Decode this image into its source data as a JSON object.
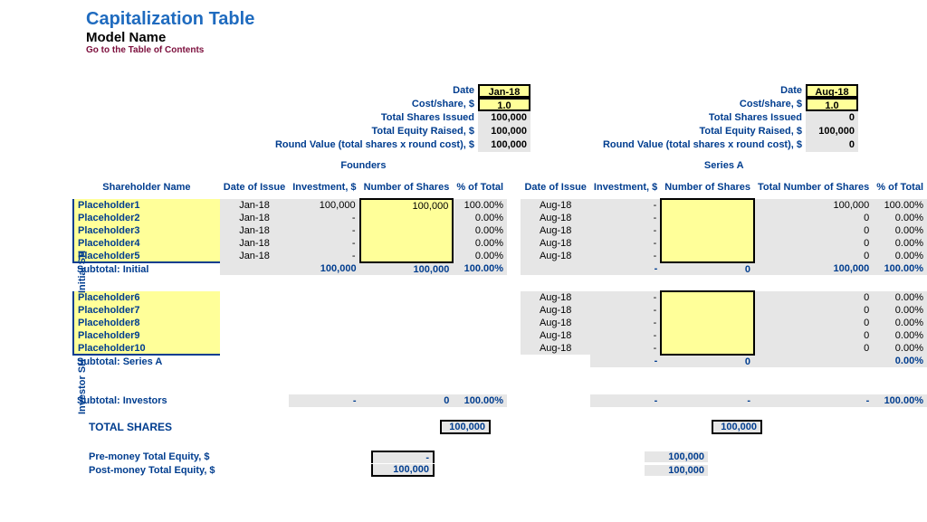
{
  "header": {
    "title": "Capitalization Table",
    "subtitle": "Model Name",
    "link": "Go to the Table of Contents"
  },
  "metrics": {
    "labels": {
      "date": "Date",
      "cost": "Cost/share, $",
      "shares": "Total Shares Issued",
      "equity": "Total Equity Raised, $",
      "roundval": "Round Value (total shares x round cost), $"
    },
    "founders": {
      "date": "Jan-18",
      "cost": "1.0",
      "shares": "100,000",
      "equity": "100,000",
      "roundval": "100,000"
    },
    "seriesA": {
      "date": "Aug-18",
      "cost": "1.0",
      "shares": "0",
      "equity": "100,000",
      "roundval": "0"
    }
  },
  "table": {
    "groups": {
      "founders": "Founders",
      "seriesA": "Series A"
    },
    "headers": {
      "shareholder": "Shareholder Name",
      "date": "Date of Issue",
      "investment": "Investment, $",
      "shares": "Number of Shares",
      "totalShares": "Total Number of Shares",
      "pct": "% of Total"
    },
    "vert": {
      "initial": "Initial SH",
      "investor": "Investor SH"
    },
    "rows_initial": [
      {
        "name": "Placeholder1",
        "f_date": "Jan-18",
        "f_inv": "100,000",
        "f_sh": "100,000",
        "f_pct": "100.00%",
        "a_date": "Aug-18",
        "a_inv": "-",
        "a_sh": "",
        "a_tsh": "100,000",
        "a_pct": "100.00%"
      },
      {
        "name": "Placeholder2",
        "f_date": "Jan-18",
        "f_inv": "-",
        "f_sh": "",
        "f_pct": "0.00%",
        "a_date": "Aug-18",
        "a_inv": "-",
        "a_sh": "",
        "a_tsh": "0",
        "a_pct": "0.00%"
      },
      {
        "name": "Placeholder3",
        "f_date": "Jan-18",
        "f_inv": "-",
        "f_sh": "",
        "f_pct": "0.00%",
        "a_date": "Aug-18",
        "a_inv": "-",
        "a_sh": "",
        "a_tsh": "0",
        "a_pct": "0.00%"
      },
      {
        "name": "Placeholder4",
        "f_date": "Jan-18",
        "f_inv": "-",
        "f_sh": "",
        "f_pct": "0.00%",
        "a_date": "Aug-18",
        "a_inv": "-",
        "a_sh": "",
        "a_tsh": "0",
        "a_pct": "0.00%"
      },
      {
        "name": "Placeholder5",
        "f_date": "Jan-18",
        "f_inv": "-",
        "f_sh": "",
        "f_pct": "0.00%",
        "a_date": "Aug-18",
        "a_inv": "-",
        "a_sh": "",
        "a_tsh": "0",
        "a_pct": "0.00%"
      }
    ],
    "subtotal_initial": {
      "label": "Subtotal: Initial",
      "f_inv": "100,000",
      "f_sh": "100,000",
      "f_pct": "100.00%",
      "a_inv": "-",
      "a_sh": "0",
      "a_tsh": "100,000",
      "a_pct": "100.00%"
    },
    "rows_investor": [
      {
        "name": "Placeholder6",
        "a_date": "Aug-18",
        "a_inv": "-",
        "a_sh": "",
        "a_tsh": "0",
        "a_pct": "0.00%"
      },
      {
        "name": "Placeholder7",
        "a_date": "Aug-18",
        "a_inv": "-",
        "a_sh": "",
        "a_tsh": "0",
        "a_pct": "0.00%"
      },
      {
        "name": "Placeholder8",
        "a_date": "Aug-18",
        "a_inv": "-",
        "a_sh": "",
        "a_tsh": "0",
        "a_pct": "0.00%"
      },
      {
        "name": "Placeholder9",
        "a_date": "Aug-18",
        "a_inv": "-",
        "a_sh": "",
        "a_tsh": "0",
        "a_pct": "0.00%"
      },
      {
        "name": "Placeholder10",
        "a_date": "Aug-18",
        "a_inv": "-",
        "a_sh": "",
        "a_tsh": "0",
        "a_pct": "0.00%"
      }
    ],
    "subtotal_seriesA": {
      "label": "Subtotal: Series A",
      "a_inv": "-",
      "a_sh": "0",
      "a_tsh": "",
      "a_pct": "0.00%"
    },
    "subtotal_investors": {
      "label": "Subtotal: Investors",
      "f_inv": "-",
      "f_sh": "0",
      "f_pct": "100.00%",
      "a_inv": "-",
      "a_sh": "-",
      "a_tsh": "-",
      "a_pct": "100.00%"
    }
  },
  "totals": {
    "totalShares": {
      "label": "TOTAL SHARES",
      "f": "100,000",
      "a": "100,000"
    },
    "preMoney": {
      "label": "Pre-money Total Equity, $",
      "f": "-",
      "a": "100,000"
    },
    "postMoney": {
      "label": "Post-money Total Equity, $",
      "f": "100,000",
      "a": "100,000"
    }
  }
}
